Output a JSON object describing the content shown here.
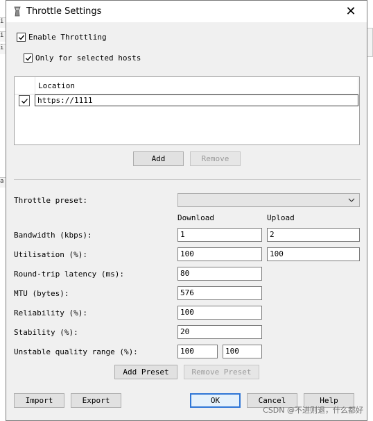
{
  "window": {
    "title": "Throttle Settings",
    "close_glyph": "✕"
  },
  "background": {
    "fragments": [
      "i",
      "i",
      "i",
      "a"
    ]
  },
  "enable_throttling": {
    "label": "Enable Throttling",
    "checked": true
  },
  "only_selected_hosts": {
    "label": "Only for selected hosts",
    "checked": true
  },
  "hosts_table": {
    "columns": [
      "",
      "Location"
    ],
    "rows": [
      {
        "checked": true,
        "location": "https://1111"
      }
    ]
  },
  "hosts_buttons": {
    "add": "Add",
    "remove": "Remove"
  },
  "preset": {
    "label": "Throttle preset:",
    "value": ""
  },
  "columns": {
    "download": "Download",
    "upload": "Upload"
  },
  "settings": {
    "bandwidth": {
      "label": "Bandwidth (kbps):",
      "download": "1",
      "upload": "2"
    },
    "utilisation": {
      "label": "Utilisation (%):",
      "download": "100",
      "upload": "100"
    },
    "latency": {
      "label": "Round-trip latency (ms):",
      "value": "80"
    },
    "mtu": {
      "label": "MTU (bytes):",
      "value": "576"
    },
    "reliability": {
      "label": "Reliability (%):",
      "value": "100"
    },
    "stability": {
      "label": "Stability (%):",
      "value": "20"
    },
    "unstable_range": {
      "label": "Unstable quality range (%):",
      "min": "100",
      "max": "100"
    }
  },
  "preset_buttons": {
    "add": "Add Preset",
    "remove": "Remove Preset"
  },
  "footer": {
    "import": "Import",
    "export": "Export",
    "ok": "OK",
    "cancel": "Cancel",
    "help": "Help"
  },
  "watermark": "CSDN @不进则退，什么都好",
  "colors": {
    "dialog_bg": "#f0f0f0",
    "default_button_border": "#2f76d6",
    "disabled_text": "#9a9a9a"
  }
}
